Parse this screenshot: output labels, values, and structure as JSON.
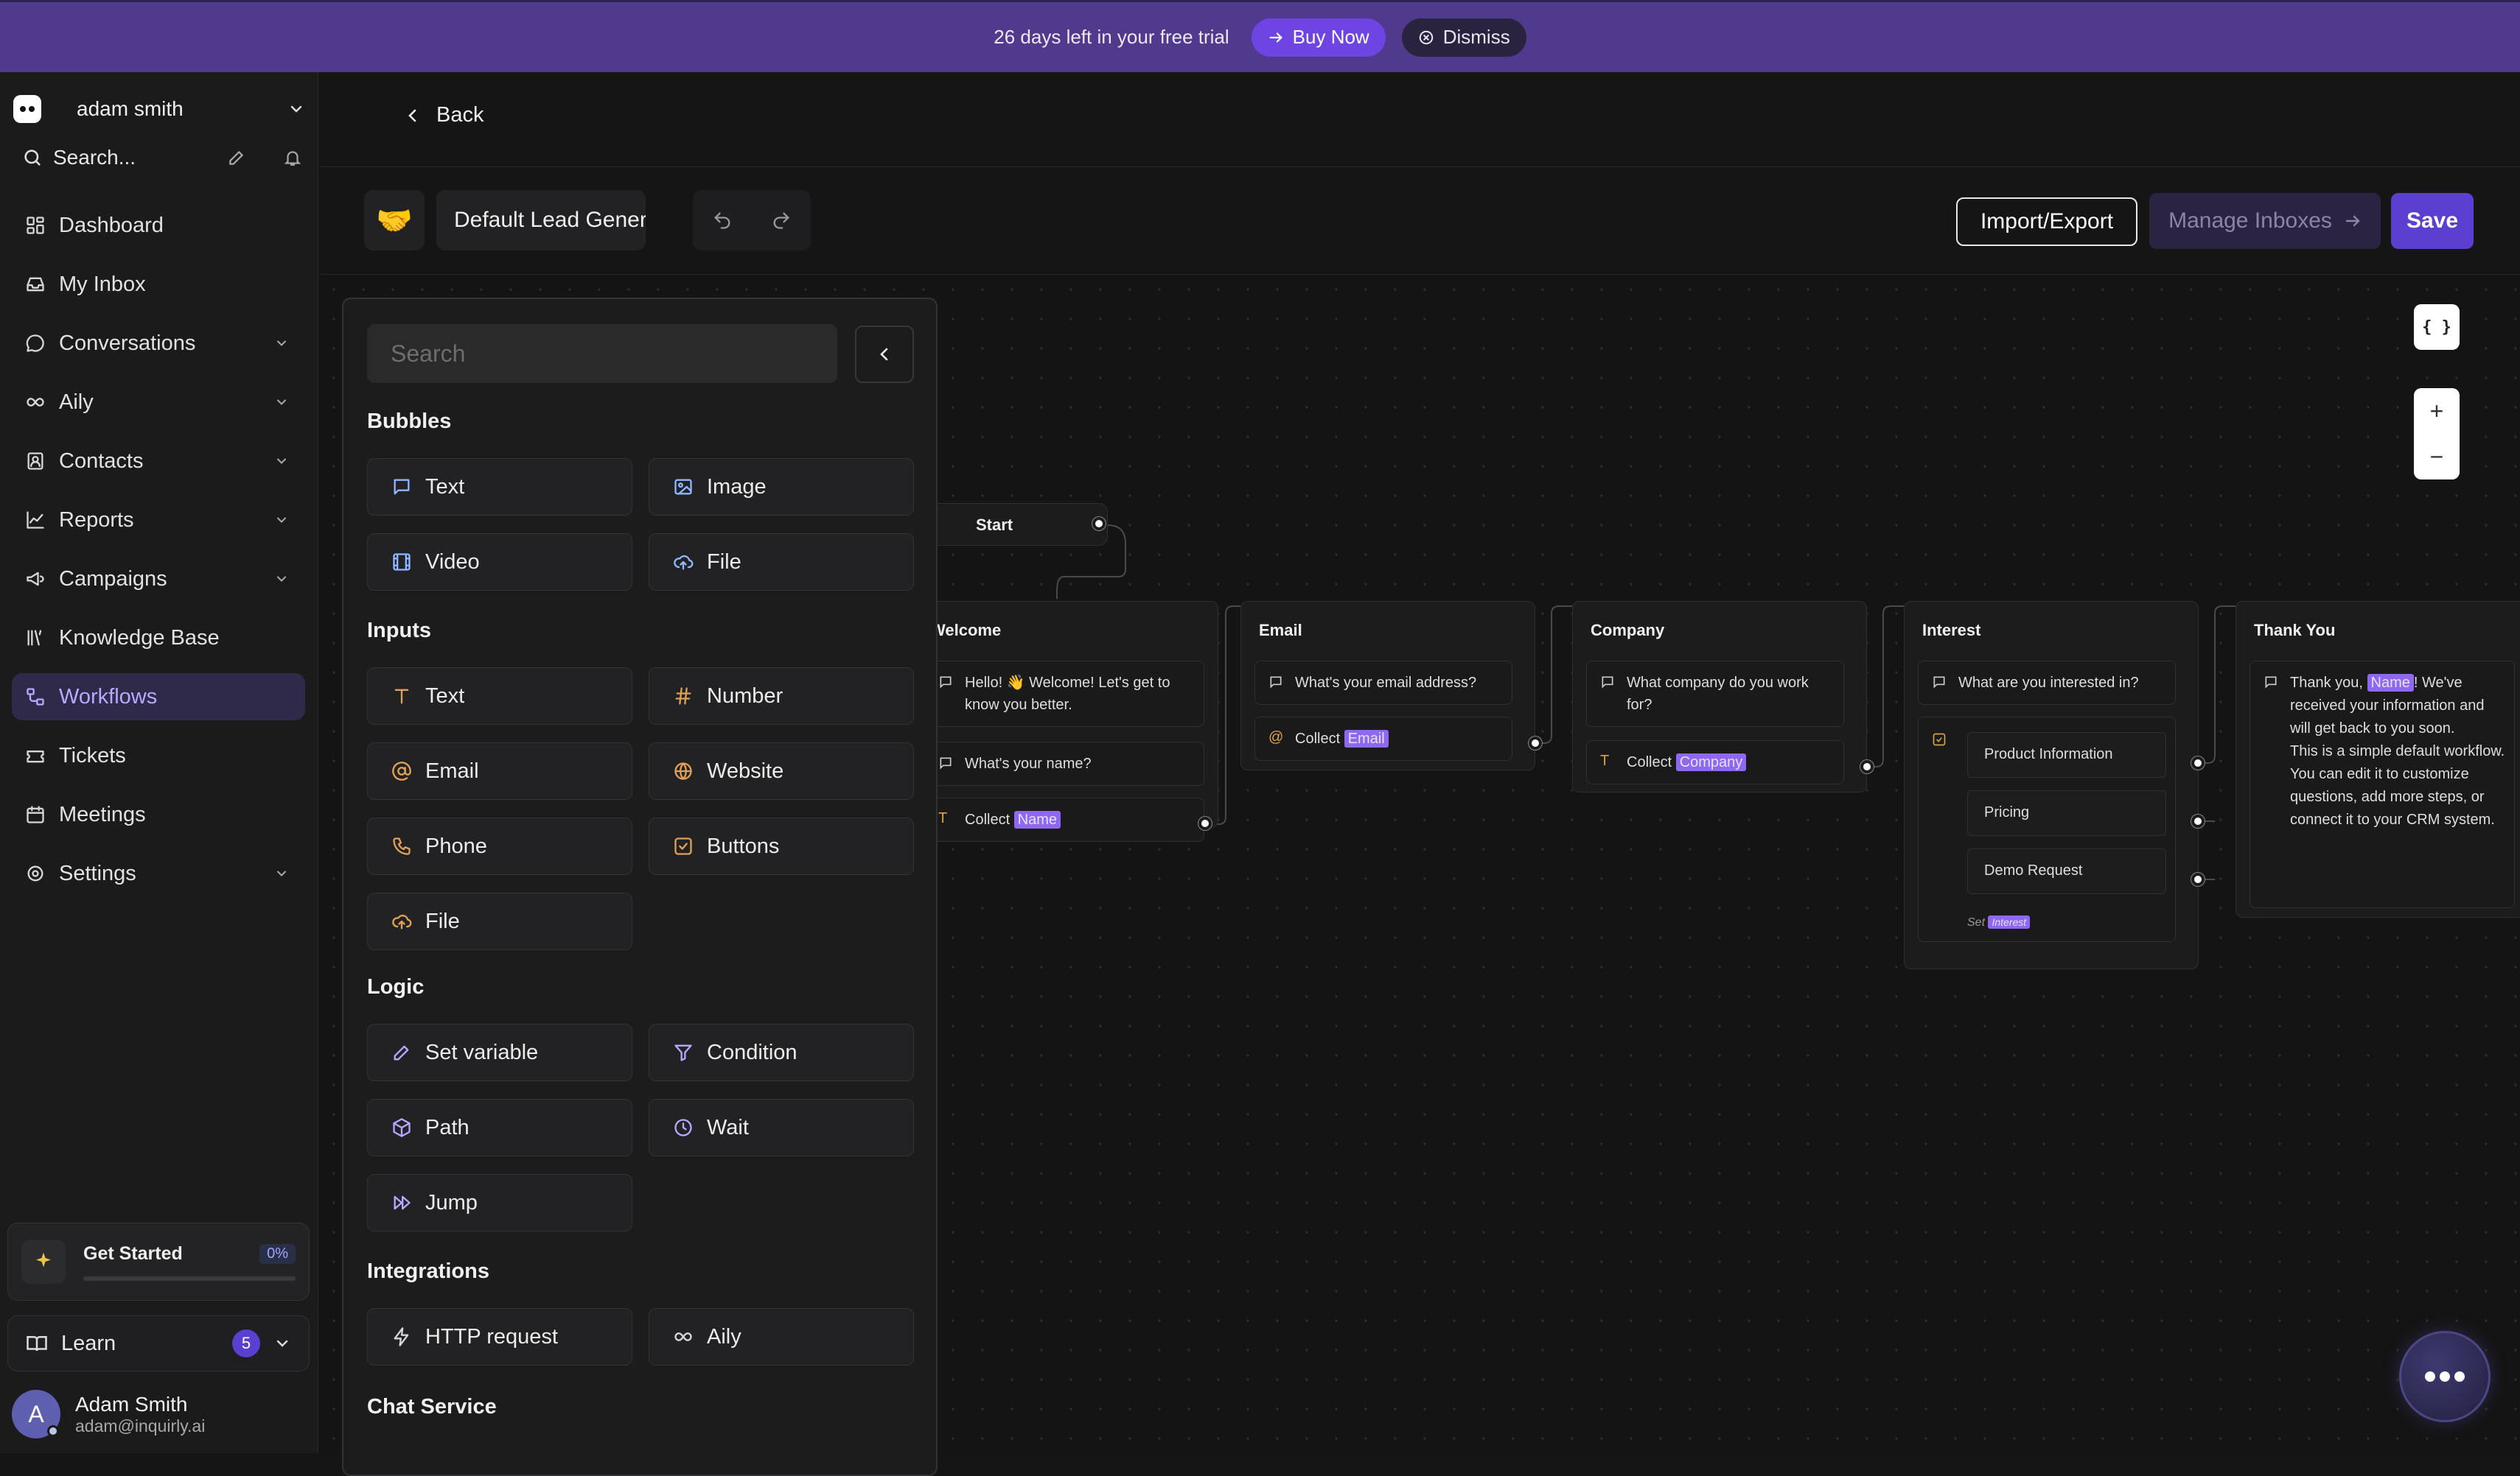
{
  "banner": {
    "text": "26 days left in your free trial",
    "buy_label": "Buy Now",
    "dismiss_label": "Dismiss"
  },
  "sidebar": {
    "workspace": "adam smith",
    "search_label": "Search...",
    "nav": [
      {
        "label": "Dashboard",
        "icon": "dashboard-icon",
        "chevron": false,
        "active": false
      },
      {
        "label": "My Inbox",
        "icon": "inbox-icon",
        "chevron": false,
        "active": false
      },
      {
        "label": "Conversations",
        "icon": "chat-icon",
        "chevron": true,
        "active": false
      },
      {
        "label": "Aily",
        "icon": "infinity-icon",
        "chevron": true,
        "active": false
      },
      {
        "label": "Contacts",
        "icon": "contacts-icon",
        "chevron": true,
        "active": false
      },
      {
        "label": "Reports",
        "icon": "chart-line-icon",
        "chevron": true,
        "active": false
      },
      {
        "label": "Campaigns",
        "icon": "megaphone-icon",
        "chevron": true,
        "active": false
      },
      {
        "label": "Knowledge Base",
        "icon": "library-icon",
        "chevron": false,
        "active": false
      },
      {
        "label": "Workflows",
        "icon": "workflow-icon",
        "chevron": false,
        "active": true
      },
      {
        "label": "Tickets",
        "icon": "ticket-icon",
        "chevron": false,
        "active": false
      },
      {
        "label": "Meetings",
        "icon": "calendar-icon",
        "chevron": false,
        "active": false
      },
      {
        "label": "Settings",
        "icon": "gear-icon",
        "chevron": true,
        "active": false
      }
    ],
    "get_started": {
      "label": "Get Started",
      "progress_label": "0%",
      "progress": 0
    },
    "learn": {
      "label": "Learn",
      "count": "5"
    },
    "user": {
      "initial": "A",
      "name": "Adam Smith",
      "email": "adam@inquirly.ai"
    }
  },
  "topbar": {
    "back_label": "Back"
  },
  "toolbar": {
    "emoji": "🤝",
    "flow_name": "Default Lead Generation",
    "import_export_label": "Import/Export",
    "manage_inboxes_label": "Manage Inboxes",
    "save_label": "Save"
  },
  "canvas": {
    "variables_label": "{ }",
    "zoom_in_label": "+",
    "zoom_out_label": "−"
  },
  "panel": {
    "search_placeholder": "Search",
    "sections": [
      {
        "title": "Bubbles",
        "items": [
          {
            "label": "Text",
            "icon": "message-icon"
          },
          {
            "label": "Image",
            "icon": "image-icon"
          },
          {
            "label": "Video",
            "icon": "film-icon"
          },
          {
            "label": "File",
            "icon": "cloud-upload-icon"
          }
        ]
      },
      {
        "title": "Inputs",
        "items": [
          {
            "label": "Text",
            "icon": "text-type-icon"
          },
          {
            "label": "Number",
            "icon": "hash-icon"
          },
          {
            "label": "Email",
            "icon": "at-sign-icon"
          },
          {
            "label": "Website",
            "icon": "globe-icon"
          },
          {
            "label": "Phone",
            "icon": "phone-icon"
          },
          {
            "label": "Buttons",
            "icon": "checkbox-icon"
          },
          {
            "label": "File",
            "icon": "cloud-upload-icon"
          }
        ]
      },
      {
        "title": "Logic",
        "items": [
          {
            "label": "Set variable",
            "icon": "pencil-icon"
          },
          {
            "label": "Condition",
            "icon": "filter-icon"
          },
          {
            "label": "Path",
            "icon": "cube-icon"
          },
          {
            "label": "Wait",
            "icon": "clock-icon"
          },
          {
            "label": "Jump",
            "icon": "fast-forward-icon"
          }
        ]
      },
      {
        "title": "Integrations",
        "items": [
          {
            "label": "HTTP request",
            "icon": "bolt-icon"
          },
          {
            "label": "Aily",
            "icon": "infinity-icon"
          }
        ]
      },
      {
        "title": "Chat Service",
        "items": []
      }
    ]
  },
  "flow": {
    "start_label": "Start",
    "nodes": {
      "welcome": {
        "title": "Welcome",
        "greeting": "Hello! 👋 Welcome! Let's get to know you better.",
        "question": "What's your name?",
        "collect_label": "Collect",
        "variable": "Name"
      },
      "email": {
        "title": "Email",
        "question": "What's your email address?",
        "collect_label": "Collect",
        "variable": "Email"
      },
      "company": {
        "title": "Company",
        "question": "What company do you work for?",
        "collect_label": "Collect",
        "variable": "Company"
      },
      "interest": {
        "title": "Interest",
        "question": "What are you interested in?",
        "options": [
          "Product Information",
          "Pricing",
          "Demo Request"
        ],
        "set_label": "Set",
        "variable": "Interest"
      },
      "thankyou": {
        "title": "Thank You",
        "text_before": "Thank you, ",
        "variable": "Name",
        "text_after": "! We've received your information and will get back to you soon.",
        "text_more": "This is a simple default workflow. You can edit it to customize questions, add more steps, or connect it to your CRM system."
      }
    }
  },
  "colors": {
    "banner": "#503a8e",
    "accent": "#5b3fd0",
    "variable_chip": "#8e68f0",
    "active_nav": "#2f2a49"
  }
}
